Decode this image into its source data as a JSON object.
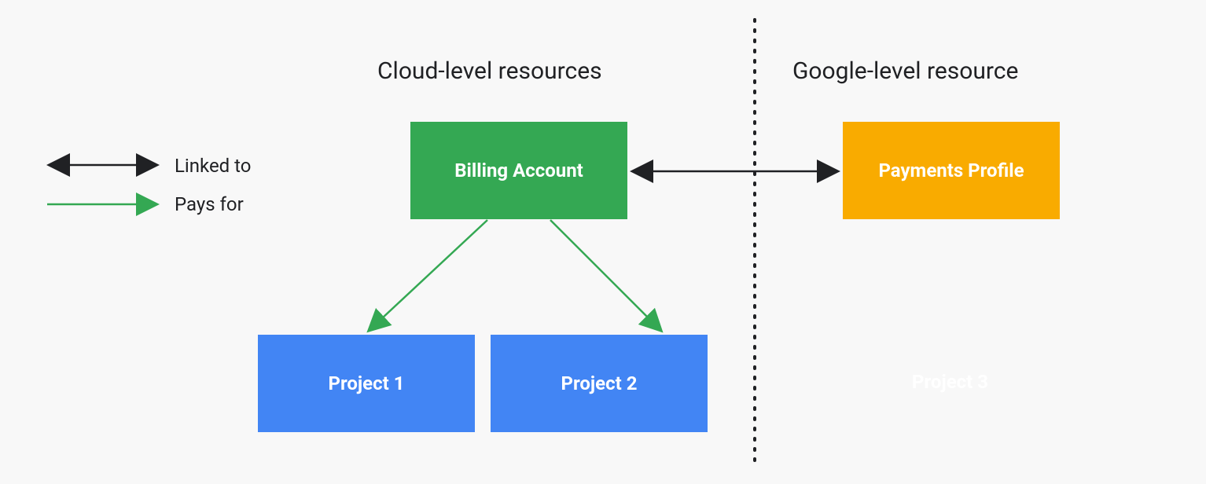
{
  "headings": {
    "cloud": "Cloud-level resources",
    "google": "Google-level resource"
  },
  "boxes": {
    "billing": "Billing Account",
    "payments": "Payments Profile",
    "project1": "Project 1",
    "project2": "Project 2",
    "project3": "Project 3"
  },
  "legend": {
    "linked": "Linked to",
    "pays": "Pays for"
  },
  "colors": {
    "green": "#34a853",
    "blue": "#4285f4",
    "yellow": "#f9ab00",
    "dark": "#202124"
  }
}
